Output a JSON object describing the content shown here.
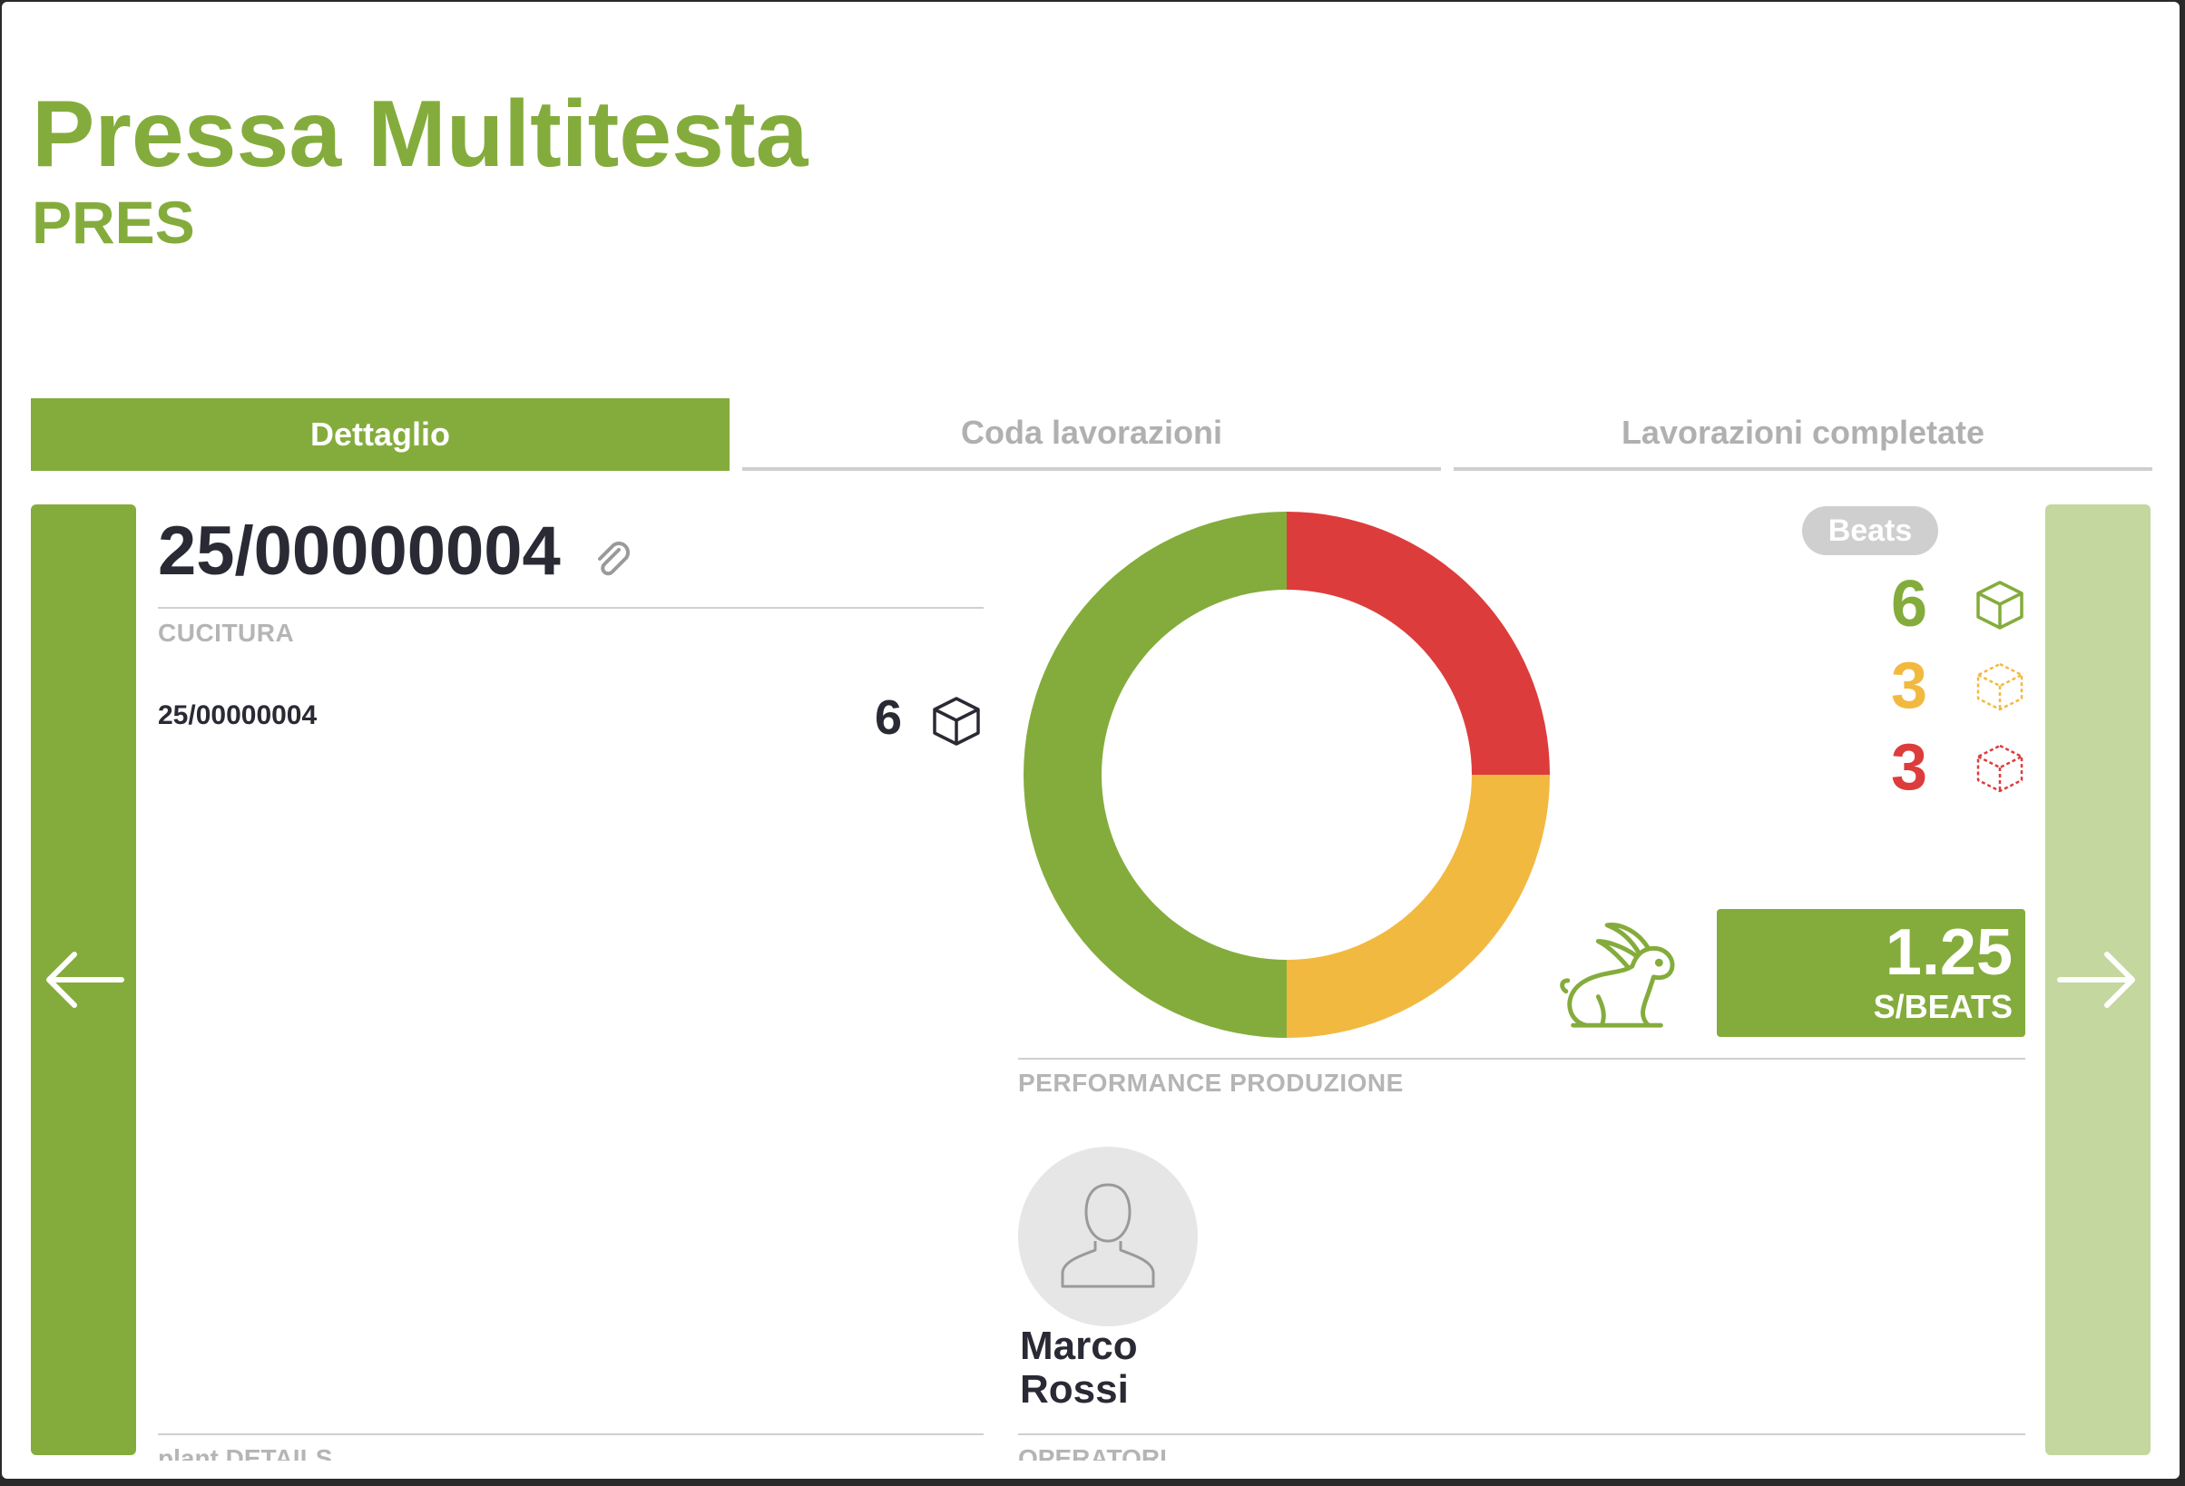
{
  "header": {
    "title": "Pressa Multitesta",
    "code": "PRES"
  },
  "tabs": [
    {
      "label": "Dettaglio",
      "active": true
    },
    {
      "label": "Coda lavorazioni",
      "active": false
    },
    {
      "label": "Lavorazioni completate",
      "active": false
    }
  ],
  "job": {
    "id": "25/00000004",
    "phase_label": "CUCITURA",
    "order_label": "25/00000004",
    "order_count": "6"
  },
  "beats": {
    "badge": "Beats",
    "good": "6",
    "warning": "3",
    "scrap": "3"
  },
  "speed": {
    "value": "1.25",
    "unit": "S/BEATS"
  },
  "performance_label": "PERFORMANCE PRODUZIONE",
  "operator": {
    "first_name": "Marco",
    "last_name": "Rossi"
  },
  "footer_labels": {
    "left": "plant DETAILS",
    "right": "OPERATORI"
  },
  "colors": {
    "brand_green": "#84ac3c",
    "light_green": "#c3d79e",
    "warning_yellow": "#f2b941",
    "scrap_red": "#dd3c3c"
  },
  "icons": [
    "clip-icon",
    "box-icon",
    "rabbit-icon",
    "user-icon",
    "arrow-left-icon",
    "arrow-right-icon"
  ]
}
